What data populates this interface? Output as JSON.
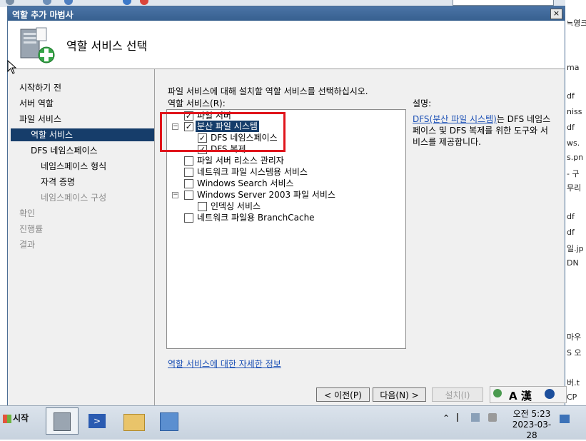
{
  "window": {
    "title": "역할 추가 마법사",
    "close_glyph": "×"
  },
  "header": {
    "title": "역할 서비스 선택",
    "icon": "server-add-icon"
  },
  "nav": {
    "items": [
      {
        "label": "시작하기 전",
        "state": "normal"
      },
      {
        "label": "서버 역할",
        "state": "normal"
      },
      {
        "label": "파일 서비스",
        "state": "normal"
      },
      {
        "label": "역할 서비스",
        "state": "selected"
      },
      {
        "label": "DFS 네임스페이스",
        "state": "normal"
      },
      {
        "label": "네임스페이스 형식",
        "state": "normal"
      },
      {
        "label": "자격 증명",
        "state": "normal"
      },
      {
        "label": "네임스페이스 구성",
        "state": "dim"
      },
      {
        "label": "확인",
        "state": "dim"
      },
      {
        "label": "진행률",
        "state": "dim"
      },
      {
        "label": "결과",
        "state": "dim"
      }
    ]
  },
  "content": {
    "instruction": "파일 서비스에 대해 설치할 역할 서비스를 선택하십시오.",
    "services_label": "역할 서비스(R):",
    "services": [
      {
        "label": "파일 서버",
        "checked": true,
        "expander": ""
      },
      {
        "label": "분산 파일 시스템",
        "checked": true,
        "expander": "−",
        "selected": true
      },
      {
        "label": "DFS 네임스페이스",
        "checked": true,
        "expander": ""
      },
      {
        "label": "DFS 복제",
        "checked": true,
        "expander": ""
      },
      {
        "label": "파일 서버 리소스 관리자",
        "checked": false,
        "expander": ""
      },
      {
        "label": "네트워크 파일 시스템용 서비스",
        "checked": false,
        "expander": ""
      },
      {
        "label": "Windows Search 서비스",
        "checked": false,
        "expander": ""
      },
      {
        "label": "Windows Server 2003 파일 서비스",
        "checked": false,
        "expander": "−"
      },
      {
        "label": "인덱싱 서비스",
        "checked": false,
        "expander": ""
      },
      {
        "label": "네트워크 파일용 BranchCache",
        "checked": false,
        "expander": ""
      }
    ],
    "more_info_link": "역할 서비스에 대한 자세한 정보",
    "description_label": "설명:",
    "description_link": "DFS(분산 파일 시스템)",
    "description_text": "는 DFS 네임스페이스 및 DFS 복제를 위한 도구와 서비스를 제공합니다."
  },
  "buttons": {
    "prev": "< 이전(P)",
    "next": "다음(N) >",
    "install": "설치(I)"
  },
  "language_bar": {
    "text": "A 漢"
  },
  "taskbar": {
    "start_label": "시작",
    "time": "오전 5:23",
    "date": "2023-03-28"
  },
  "background_fragments": [
    "≒영크",
    "ma",
    "df",
    "niss",
    "df",
    "ws.",
    "s.pn",
    "- 구",
    "무리",
    "df",
    "df",
    "일.jp",
    "DN",
    "마우",
    "S 오",
    "버.t",
    "CP"
  ],
  "colors": {
    "title_bar": "#3f6a9b",
    "selection": "#163d6a",
    "highlight_box": "#e0141b",
    "link": "#1a4fb5"
  }
}
